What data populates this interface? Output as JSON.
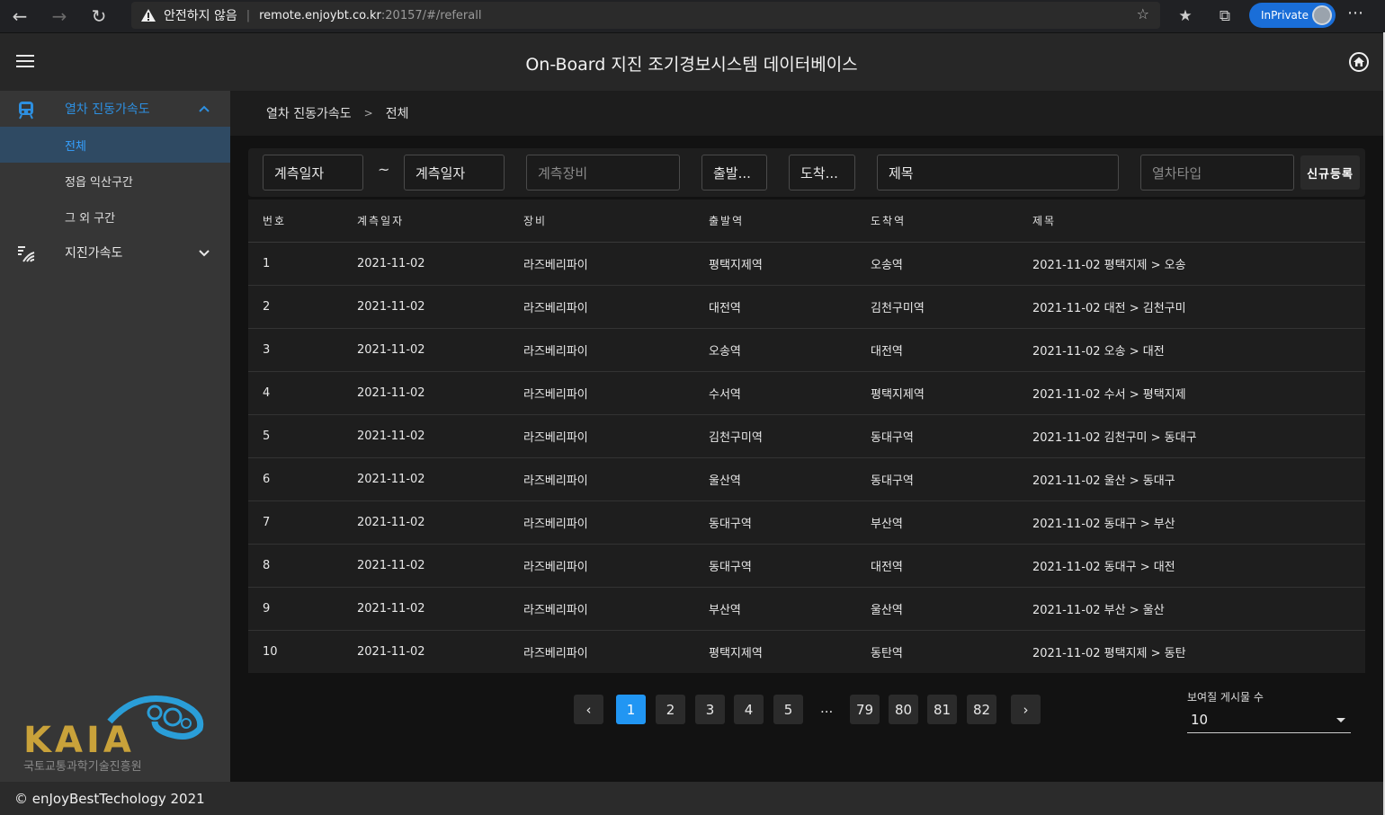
{
  "browser": {
    "warning": "안전하지 않음",
    "url_host": "remote.enjoybt.co.kr",
    "url_rest": ":20157/#/referall",
    "inprivate": "InPrivate"
  },
  "header": {
    "title": "On-Board 지진 조기경보시스템 데이터베이스"
  },
  "sidebar": {
    "group1": "열차 진동가속도",
    "sub_all": "전체",
    "sub_jeongeup": "정읍 익산구간",
    "sub_other": "그 외 구간",
    "group2": "지진가속도",
    "logo_text": "KAIA",
    "logo_sub": "국토교통과학기술진흥원"
  },
  "breadcrumb": {
    "level1": "열차 진동가속도",
    "sep": ">",
    "level2": "전체"
  },
  "filters": {
    "date_from": "계측일자",
    "tilde": "~",
    "date_to": "계측일자",
    "device_placeholder": "계측장비",
    "departure": "출발...",
    "arrival": "도착...",
    "title": "제목",
    "train_type_placeholder": "열차타입",
    "new_button": "신규등록"
  },
  "table": {
    "headers": [
      "번호",
      "계측일자",
      "장비",
      "출발역",
      "도착역",
      "제목"
    ],
    "rows": [
      [
        "1",
        "2021-11-02",
        "라즈베리파이",
        "평택지제역",
        "오송역",
        "2021-11-02 평택지제 > 오송"
      ],
      [
        "2",
        "2021-11-02",
        "라즈베리파이",
        "대전역",
        "김천구미역",
        "2021-11-02 대전 > 김천구미"
      ],
      [
        "3",
        "2021-11-02",
        "라즈베리파이",
        "오송역",
        "대전역",
        "2021-11-02 오송 > 대전"
      ],
      [
        "4",
        "2021-11-02",
        "라즈베리파이",
        "수서역",
        "평택지제역",
        "2021-11-02 수서 > 평택지제"
      ],
      [
        "5",
        "2021-11-02",
        "라즈베리파이",
        "김천구미역",
        "동대구역",
        "2021-11-02 김천구미 > 동대구"
      ],
      [
        "6",
        "2021-11-02",
        "라즈베리파이",
        "울산역",
        "동대구역",
        "2021-11-02 울산 > 동대구"
      ],
      [
        "7",
        "2021-11-02",
        "라즈베리파이",
        "동대구역",
        "부산역",
        "2021-11-02 동대구 > 부산"
      ],
      [
        "8",
        "2021-11-02",
        "라즈베리파이",
        "동대구역",
        "대전역",
        "2021-11-02 동대구 > 대전"
      ],
      [
        "9",
        "2021-11-02",
        "라즈베리파이",
        "부산역",
        "울산역",
        "2021-11-02 부산 > 울산"
      ],
      [
        "10",
        "2021-11-02",
        "라즈베리파이",
        "평택지제역",
        "동탄역",
        "2021-11-02 평택지제 > 동탄"
      ]
    ]
  },
  "pagination": {
    "prev": "‹",
    "pages": [
      "1",
      "2",
      "3",
      "4",
      "5"
    ],
    "dots": "...",
    "last_pages": [
      "79",
      "80",
      "81",
      "82"
    ],
    "next": "›",
    "current": "1"
  },
  "rows_per_page": {
    "label": "보여질 게시물 수",
    "value": "10"
  },
  "footer": {
    "text": "© enJoyBestTechology 2021"
  },
  "colors": {
    "accent": "#2196f3",
    "active_nav_bg": "#2f4a63",
    "sidebar_bg": "#363636"
  }
}
